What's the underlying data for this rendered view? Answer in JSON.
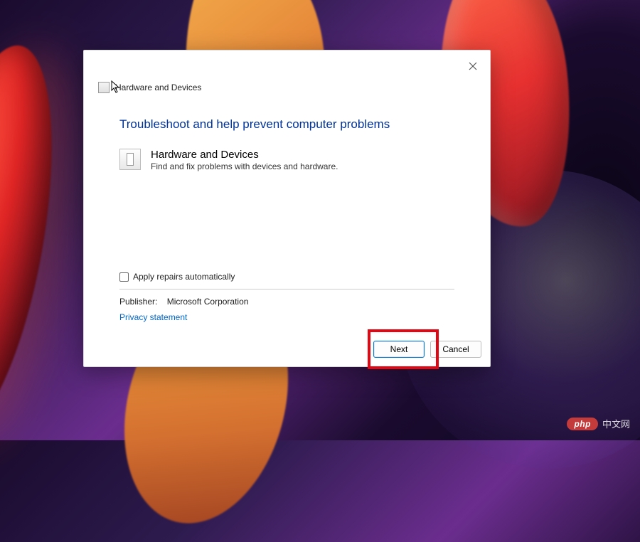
{
  "dialog": {
    "title": "Hardware and Devices",
    "heading": "Troubleshoot and help prevent computer problems",
    "item": {
      "title": "Hardware and Devices",
      "description": "Find and fix problems with devices and hardware."
    },
    "checkbox_label": "Apply repairs automatically",
    "publisher_label": "Publisher:",
    "publisher_value": "Microsoft Corporation",
    "privacy_link": "Privacy statement",
    "buttons": {
      "next": "Next",
      "cancel": "Cancel"
    }
  },
  "watermark": {
    "badge": "php",
    "text": "中文网"
  }
}
